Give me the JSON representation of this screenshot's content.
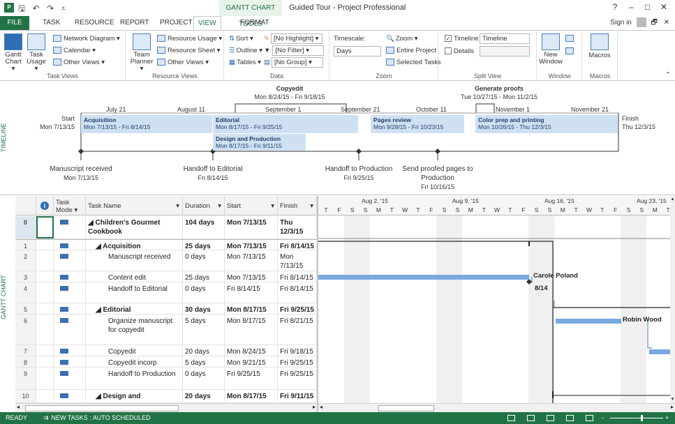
{
  "titlebar": {
    "app_icon": "P",
    "tools_label": "GANTT CHART TOOLS",
    "title": "Guided Tour - Project Professional",
    "help": "?",
    "minimize": "–",
    "restore": "□",
    "close": "✕"
  },
  "tabs": [
    {
      "label": "FILE"
    },
    {
      "label": "TASK"
    },
    {
      "label": "RESOURCE"
    },
    {
      "label": "REPORT"
    },
    {
      "label": "PROJECT"
    },
    {
      "label": "VIEW"
    },
    {
      "label": "FORMAT"
    }
  ],
  "signin": "Sign in",
  "ribbon": {
    "task_views": {
      "label": "Task Views",
      "gantt": "Gantt Chart ▾",
      "task_usage": "Task Usage ▾",
      "network": "Network Diagram ▾",
      "calendar": "Calendar ▾",
      "other": "Other Views ▾"
    },
    "resource_views": {
      "label": "Resource Views",
      "team_planner": "Team Planner ▾",
      "resource_usage": "Resource Usage ▾",
      "resource_sheet": "Resource Sheet ▾",
      "other": "Other Views ▾"
    },
    "data": {
      "label": "Data",
      "sort": "Sort ▾",
      "outline": "Outline ▾",
      "tables": "Tables ▾",
      "highlight": "[No Highlight] ▾",
      "filter": "[No Filter] ▾",
      "group": "[No Group] ▾"
    },
    "zoom": {
      "label": "Zoom",
      "timescale_label": "Timescale:",
      "timescale_value": "Days",
      "zoom": "Zoom ▾",
      "entire_project": "Entire Project",
      "selected_tasks": "Selected Tasks"
    },
    "split_view": {
      "label": "Split View",
      "timeline_chk": "Timeline",
      "timeline_value": "Timeline",
      "details_chk": "Details"
    },
    "window": {
      "label": "Window",
      "new_window": "New Window"
    },
    "macros": {
      "label": "Macros",
      "macros": "Macros"
    }
  },
  "timeline": {
    "side_label": "TIMELINE",
    "start_label": "Start",
    "start_date": "Mon 7/13/15",
    "finish_label": "Finish",
    "finish_date": "Thu 12/3/15",
    "months": [
      "July 21",
      "August 11",
      "September 1",
      "September 21",
      "October 11",
      "November 1",
      "November 21"
    ],
    "callouts": [
      {
        "name": "Copyedit",
        "dates": "Mon 8/24/15 - Fri 9/18/15"
      },
      {
        "name": "Generate proofs",
        "dates": "Tue 10/27/15 - Mon 11/2/15"
      }
    ],
    "bars": [
      {
        "name": "Acquisition",
        "dates": "Mon 7/13/15 - Fri 8/14/15"
      },
      {
        "name": "Editorial",
        "dates": "Mon 8/17/15 - Fri 9/25/15"
      },
      {
        "name": "Design and Production",
        "dates": "Mon 8/17/15 - Fri 9/11/15"
      },
      {
        "name": "Pages review",
        "dates": "Mon 9/28/15 - Fri 10/23/15"
      },
      {
        "name": "Color prep and printing",
        "dates": "Mon 10/26/15 - Thu 12/3/15"
      }
    ],
    "milestones": [
      {
        "name": "Manuscript received",
        "date": "Mon 7/13/15"
      },
      {
        "name": "Handoff to Editorial",
        "date": "Fri 8/14/15"
      },
      {
        "name": "Handoff to Production",
        "date": "Fri 9/25/15"
      },
      {
        "name1": "Send proofed pages to",
        "name2": "Production",
        "date": "Fri 10/16/15"
      }
    ]
  },
  "gantt": {
    "side_label": "GANTT CHART",
    "headers": {
      "info": "i",
      "mode": "Task Mode ▾",
      "name": "Task Name",
      "duration": "Duration",
      "start": "Start",
      "finish": "Finish"
    },
    "rows": [
      {
        "id": "0",
        "name": "◢ Children's Gourmet Cookbook",
        "duration": "104 days",
        "start": "Mon 7/13/15",
        "finish": "Thu 12/3/15"
      },
      {
        "id": "1",
        "name": "◢ Acquisition",
        "duration": "25 days",
        "start": "Mon 7/13/15",
        "finish": "Fri 8/14/15"
      },
      {
        "id": "2",
        "name": "Manuscript received",
        "duration": "0 days",
        "start": "Mon 7/13/15",
        "finish": "Mon 7/13/15"
      },
      {
        "id": "3",
        "name": "Content edit",
        "duration": "25 days",
        "start": "Mon 7/13/15",
        "finish": "Fri 8/14/15"
      },
      {
        "id": "4",
        "name": "Handoff to Editorial",
        "duration": "0 days",
        "start": "Fri 8/14/15",
        "finish": "Fri 8/14/15"
      },
      {
        "id": "5",
        "name": "◢ Editorial",
        "duration": "30 days",
        "start": "Mon 8/17/15",
        "finish": "Fri 9/25/15"
      },
      {
        "id": "6",
        "name": "Organize manuscript for copyedit",
        "duration": "5 days",
        "start": "Mon 8/17/15",
        "finish": "Fri 8/21/15"
      },
      {
        "id": "7",
        "name": "Copyedit",
        "duration": "20 days",
        "start": "Mon 8/24/15",
        "finish": "Fri 9/18/15"
      },
      {
        "id": "8",
        "name": "Copyedit incorp",
        "duration": "5 days",
        "start": "Mon 9/21/15",
        "finish": "Fri 9/25/15"
      },
      {
        "id": "9",
        "name": "Handoff to Production",
        "duration": "0 days",
        "start": "Fri 9/25/15",
        "finish": "Fri 9/25/15"
      },
      {
        "id": "10",
        "name": "◢ Design and",
        "duration": "20 days",
        "start": "Mon 8/17/15",
        "finish": "Fri 9/11/15"
      }
    ],
    "weeks": [
      "Aug 2, '15",
      "Aug 9, '15",
      "Aug 16, '15",
      "Aug 23, '15"
    ],
    "days": [
      "T",
      "F",
      "S",
      "S",
      "M",
      "T",
      "W",
      "T",
      "F",
      "S",
      "S",
      "M",
      "T",
      "W",
      "T",
      "F",
      "S",
      "S",
      "M",
      "T",
      "W",
      "T",
      "F",
      "S",
      "S",
      "M",
      "T"
    ],
    "bar_labels": {
      "carole": "Carole Poland",
      "milestone": "8/14",
      "robin": "Robin Wood"
    }
  },
  "status": {
    "ready": "READY",
    "new_tasks": "NEW TASKS : AUTO SCHEDULED",
    "zoom_minus": "-",
    "zoom_plus": "+"
  }
}
